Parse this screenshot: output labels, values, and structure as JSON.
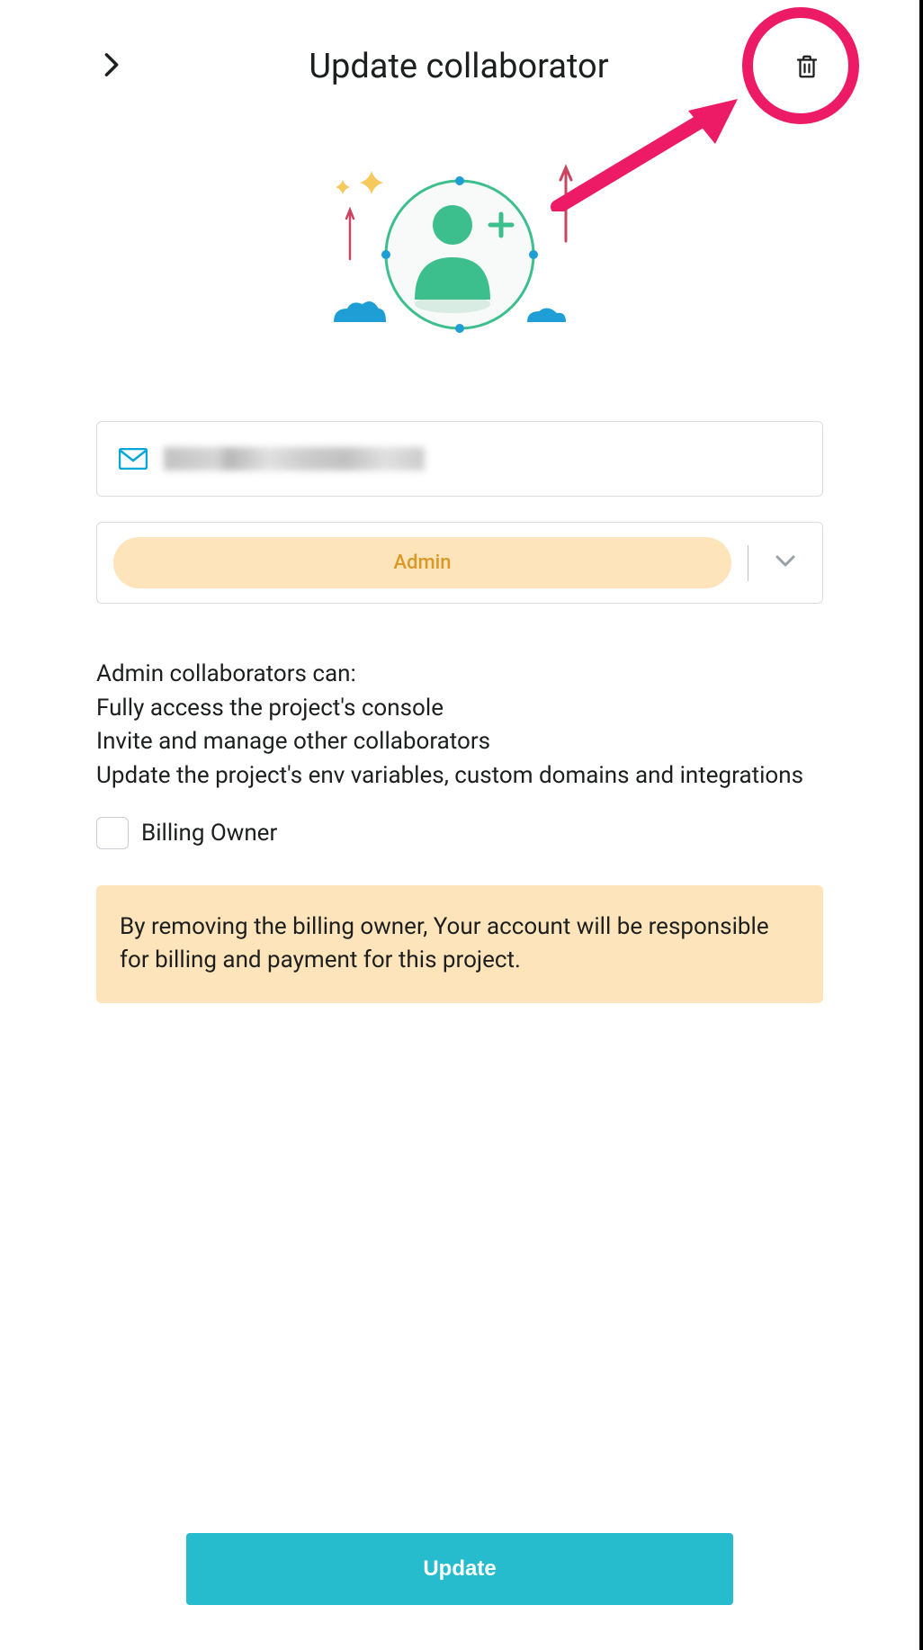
{
  "header": {
    "title": "Update collaborator"
  },
  "form": {
    "role": "Admin",
    "billing_owner_label": "Billing Owner"
  },
  "description": {
    "intro": "Admin collaborators can:",
    "line1": "Fully access the project's console",
    "line2": "Invite and manage other collaborators",
    "line3": "Update the project's env variables, custom domains and integrations"
  },
  "warning": "By removing the billing owner, Your account will be responsible for billing and payment for this project.",
  "footer": {
    "submit_label": "Update"
  }
}
